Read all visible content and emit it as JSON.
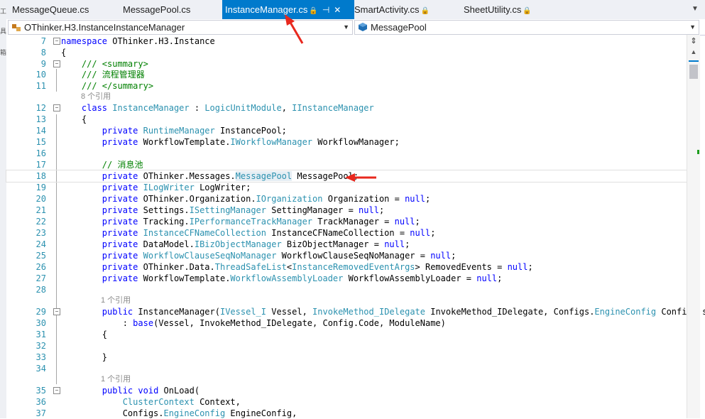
{
  "tabs": [
    {
      "label": "MessageQueue.cs",
      "locked": false,
      "active": false
    },
    {
      "label": "MessagePool.cs",
      "locked": false,
      "active": false
    },
    {
      "label": "InstanceManager.cs",
      "locked": true,
      "active": true
    },
    {
      "label": "SmartActivity.cs",
      "locked": true,
      "active": false
    },
    {
      "label": "SheetUtility.cs",
      "locked": true,
      "active": false
    }
  ],
  "nav": {
    "class_combo": "OThinker.H3.InstanceInstanceManager",
    "member_combo": "MessagePool"
  },
  "left_strip": [
    "工",
    "具",
    "箱"
  ],
  "codelens": {
    "l11": "8 个引用",
    "l28": "1 个引用",
    "l34": "1 个引用"
  },
  "colors": {
    "accent": "#007acc",
    "keyword": "#0000ff",
    "type": "#2b91af",
    "comment": "#008000",
    "annotation_arrow": "#e8281e"
  },
  "icons": [
    "lock-icon",
    "pin-icon",
    "close-icon",
    "dropdown-arrow-icon",
    "class-icon",
    "member-icon",
    "split-icon"
  ],
  "code_lines": [
    {
      "n": "7",
      "parts": [
        [
          "kw",
          "namespace"
        ],
        [
          "",
          " OThinker.H3.Instance"
        ]
      ]
    },
    {
      "n": "8",
      "parts": [
        [
          "",
          "{"
        ]
      ]
    },
    {
      "n": "9",
      "parts": [
        [
          "cm",
          "    /// <summary>"
        ]
      ]
    },
    {
      "n": "10",
      "parts": [
        [
          "cm",
          "    /// 流程管理器"
        ]
      ]
    },
    {
      "n": "11",
      "parts": [
        [
          "cm",
          "    /// </summary>"
        ]
      ]
    },
    {
      "n": "12",
      "parts": [
        [
          "",
          "    "
        ],
        [
          "kw",
          "class"
        ],
        [
          "",
          " "
        ],
        [
          "ty",
          "InstanceManager"
        ],
        [
          "",
          " : "
        ],
        [
          "ty",
          "LogicUnitModule"
        ],
        [
          "",
          ", "
        ],
        [
          "ty",
          "IInstanceManager"
        ]
      ]
    },
    {
      "n": "13",
      "parts": [
        [
          "",
          "    {"
        ]
      ]
    },
    {
      "n": "14",
      "parts": [
        [
          "",
          "        "
        ],
        [
          "kw",
          "private"
        ],
        [
          "",
          " "
        ],
        [
          "ty",
          "RuntimeManager"
        ],
        [
          "",
          " InstancePool;"
        ]
      ]
    },
    {
      "n": "15",
      "parts": [
        [
          "",
          "        "
        ],
        [
          "kw",
          "private"
        ],
        [
          "",
          " WorkflowTemplate."
        ],
        [
          "ty",
          "IWorkflowManager"
        ],
        [
          "",
          " WorkflowManager;"
        ]
      ]
    },
    {
      "n": "16",
      "parts": [
        [
          "",
          ""
        ]
      ]
    },
    {
      "n": "17",
      "parts": [
        [
          "cm",
          "        // 消息池"
        ]
      ]
    },
    {
      "n": "18",
      "parts": [
        [
          "",
          "        "
        ],
        [
          "kw",
          "private"
        ],
        [
          "",
          " OThinker.Messages."
        ],
        [
          "tyhl",
          "MessagePool"
        ],
        [
          "",
          " MessagePool;"
        ]
      ]
    },
    {
      "n": "19",
      "parts": [
        [
          "",
          "        "
        ],
        [
          "kw",
          "private"
        ],
        [
          "",
          " "
        ],
        [
          "ty",
          "ILogWriter"
        ],
        [
          "",
          " LogWriter;"
        ]
      ]
    },
    {
      "n": "20",
      "parts": [
        [
          "",
          "        "
        ],
        [
          "kw",
          "private"
        ],
        [
          "",
          " OThinker.Organization."
        ],
        [
          "ty",
          "IOrganization"
        ],
        [
          "",
          " Organization = "
        ],
        [
          "kw",
          "null"
        ],
        [
          "",
          ";"
        ]
      ]
    },
    {
      "n": "21",
      "parts": [
        [
          "",
          "        "
        ],
        [
          "kw",
          "private"
        ],
        [
          "",
          " Settings."
        ],
        [
          "ty",
          "ISettingManager"
        ],
        [
          "",
          " SettingManager = "
        ],
        [
          "kw",
          "null"
        ],
        [
          "",
          ";"
        ]
      ]
    },
    {
      "n": "22",
      "parts": [
        [
          "",
          "        "
        ],
        [
          "kw",
          "private"
        ],
        [
          "",
          " Tracking."
        ],
        [
          "ty",
          "IPerformanceTrackManager"
        ],
        [
          "",
          " TrackManager = "
        ],
        [
          "kw",
          "null"
        ],
        [
          "",
          ";"
        ]
      ]
    },
    {
      "n": "23",
      "parts": [
        [
          "",
          "        "
        ],
        [
          "kw",
          "private"
        ],
        [
          "",
          " "
        ],
        [
          "ty",
          "InstanceCFNameCollection"
        ],
        [
          "",
          " InstanceCFNameCollection = "
        ],
        [
          "kw",
          "null"
        ],
        [
          "",
          ";"
        ]
      ]
    },
    {
      "n": "24",
      "parts": [
        [
          "",
          "        "
        ],
        [
          "kw",
          "private"
        ],
        [
          "",
          " DataModel."
        ],
        [
          "ty",
          "IBizObjectManager"
        ],
        [
          "",
          " BizObjectManager = "
        ],
        [
          "kw",
          "null"
        ],
        [
          "",
          ";"
        ]
      ]
    },
    {
      "n": "25",
      "parts": [
        [
          "",
          "        "
        ],
        [
          "kw",
          "private"
        ],
        [
          "",
          " "
        ],
        [
          "ty",
          "WorkflowClauseSeqNoManager"
        ],
        [
          "",
          " WorkflowClauseSeqNoManager = "
        ],
        [
          "kw",
          "null"
        ],
        [
          "",
          ";"
        ]
      ]
    },
    {
      "n": "26",
      "parts": [
        [
          "",
          "        "
        ],
        [
          "kw",
          "private"
        ],
        [
          "",
          " OThinker.Data."
        ],
        [
          "ty",
          "ThreadSafeList"
        ],
        [
          "",
          "<"
        ],
        [
          "ty",
          "InstanceRemovedEventArgs"
        ],
        [
          "",
          "> RemovedEvents = "
        ],
        [
          "kw",
          "null"
        ],
        [
          "",
          ";"
        ]
      ]
    },
    {
      "n": "27",
      "parts": [
        [
          "",
          "        "
        ],
        [
          "kw",
          "private"
        ],
        [
          "",
          " WorkflowTemplate."
        ],
        [
          "ty",
          "WorkflowAssemblyLoader"
        ],
        [
          "",
          " WorkflowAssemblyLoader = "
        ],
        [
          "kw",
          "null"
        ],
        [
          "",
          ";"
        ]
      ]
    },
    {
      "n": "28",
      "parts": [
        [
          "",
          ""
        ]
      ]
    },
    {
      "n": "29",
      "parts": [
        [
          "",
          "        "
        ],
        [
          "kw",
          "public"
        ],
        [
          "",
          " InstanceManager("
        ],
        [
          "ty",
          "IVessel_I"
        ],
        [
          "",
          " Vessel, "
        ],
        [
          "ty",
          "InvokeMethod_IDelegate"
        ],
        [
          "",
          " InvokeMethod_IDelegate, Configs."
        ],
        [
          "ty",
          "EngineConfig"
        ],
        [
          "",
          " Config, s"
        ]
      ]
    },
    {
      "n": "30",
      "parts": [
        [
          "",
          "            : "
        ],
        [
          "kw",
          "base"
        ],
        [
          "",
          "(Vessel, InvokeMethod_IDelegate, Config.Code, ModuleName)"
        ]
      ]
    },
    {
      "n": "31",
      "parts": [
        [
          "",
          "        {"
        ]
      ]
    },
    {
      "n": "32",
      "parts": [
        [
          "",
          ""
        ]
      ]
    },
    {
      "n": "33",
      "parts": [
        [
          "",
          "        }"
        ]
      ]
    },
    {
      "n": "34",
      "parts": [
        [
          "",
          ""
        ]
      ]
    },
    {
      "n": "35",
      "parts": [
        [
          "",
          "        "
        ],
        [
          "kw",
          "public"
        ],
        [
          "",
          " "
        ],
        [
          "kw",
          "void"
        ],
        [
          "",
          " OnLoad("
        ]
      ]
    },
    {
      "n": "36",
      "parts": [
        [
          "",
          "            "
        ],
        [
          "ty",
          "ClusterContext"
        ],
        [
          "",
          " Context,"
        ]
      ]
    },
    {
      "n": "37",
      "parts": [
        [
          "",
          "            Configs."
        ],
        [
          "ty",
          "EngineConfig"
        ],
        [
          "",
          " EngineConfig,"
        ]
      ]
    }
  ]
}
